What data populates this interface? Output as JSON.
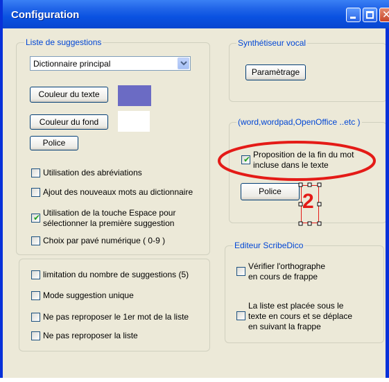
{
  "window": {
    "title": "Configuration",
    "controls": {
      "minimize": "minimize",
      "maximize": "maximize",
      "close": "close"
    }
  },
  "suggestions_group": {
    "legend": "Liste de suggestions",
    "dictionary_select": {
      "value": "Dictionnaire principal"
    },
    "text_color_button": "Couleur du texte",
    "text_color": "#6B6BC4",
    "background_color_button": "Couleur du fond",
    "background_color": "#FFFFFF",
    "font_button": "Police",
    "options": [
      {
        "label": "Utilisation des abréviations",
        "checked": false
      },
      {
        "label": "Ajout des nouveaux mots au dictionnaire",
        "checked": false
      },
      {
        "label_line1": "Utilisation de  la  touche Espace pour",
        "label_line2": "sélectionner la première suggestion",
        "checked": true
      },
      {
        "label": "Choix par pavé numérique ( 0-9 )",
        "checked": false
      }
    ]
  },
  "limits_group": {
    "options": [
      {
        "label": "limitation du  nombre de suggestions (5)",
        "checked": false
      },
      {
        "label": "Mode suggestion unique",
        "checked": false
      },
      {
        "label": "Ne pas reproposer le 1er mot de la liste",
        "checked": false
      },
      {
        "label": "Ne pas reproposer la liste",
        "checked": false
      }
    ]
  },
  "voice_group": {
    "legend": "Synthétiseur vocal",
    "settings_button": "Paramètrage"
  },
  "apps_group": {
    "legend": "(word,wordpad,OpenOffice ..etc )",
    "completion_option": {
      "label_line1": "Proposition de la fin  du mot",
      "label_line2": "incluse dans le texte",
      "checked": true
    },
    "font_button": "Police",
    "annotation_number": "2",
    "annotation_color": "#E41B17"
  },
  "editor_group": {
    "legend": "Editeur ScribeDico",
    "options": [
      {
        "label_line1": "Vérifier l'orthographe",
        "label_line2": "en cours de frappe",
        "checked": false
      },
      {
        "label_line1": "La liste est placée sous le",
        "label_line2": "texte en cours et se déplace",
        "label_line3": "en suivant la frappe",
        "checked": false
      }
    ]
  },
  "colors": {
    "titlebar": "#0A52E1",
    "dialog_bg": "#ECE9D8",
    "legend_text": "#0046D5",
    "check_mark": "#21A121"
  }
}
